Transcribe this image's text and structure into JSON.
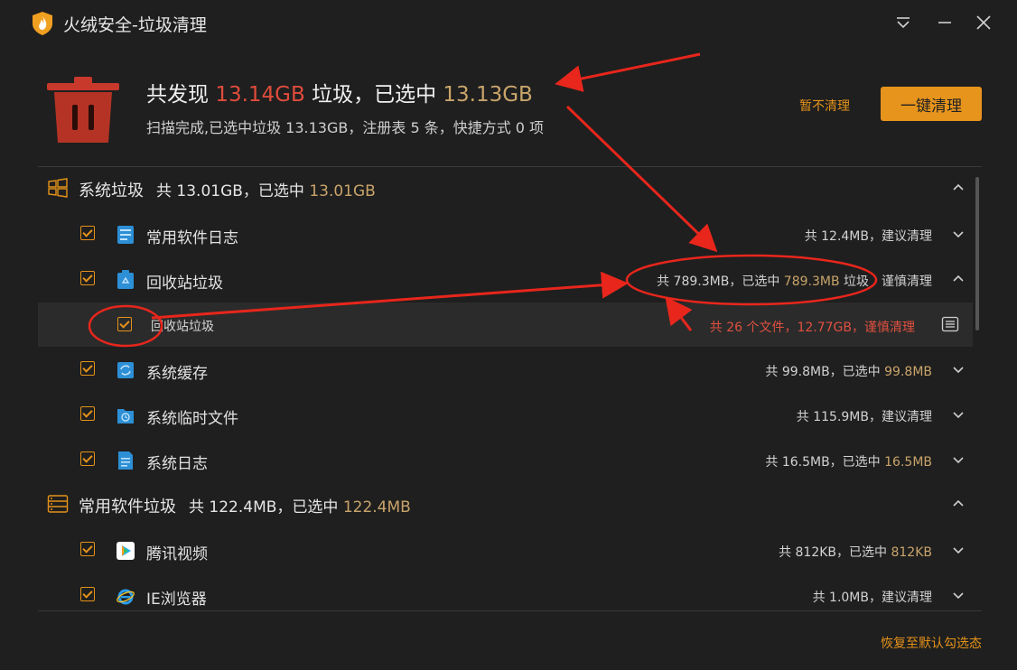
{
  "window": {
    "title": "火绒安全-垃圾清理"
  },
  "summary": {
    "prefix": "共发现 ",
    "found": "13.14GB",
    "middle": " 垃圾，已选中 ",
    "selected": "13.13GB",
    "subline": "扫描完成,已选中垃圾 13.13GB，注册表 5 条，快捷方式 0 项",
    "skip_label": "暂不清理",
    "clean_label": "一键清理"
  },
  "categories": [
    {
      "name": "系统垃圾",
      "sum_prefix": "共 13.01GB，已选中 ",
      "sum_value": "13.01GB"
    },
    {
      "name": "常用软件垃圾",
      "sum_prefix": "共 122.4MB，已选中 ",
      "sum_value": "122.4MB"
    }
  ],
  "items": [
    {
      "name": "常用软件日志",
      "stat_prefix": "共 12.4MB，建议清理",
      "stat_value": "",
      "stat_suffix": ""
    },
    {
      "name": "回收站垃圾",
      "stat_prefix": "共 789.3MB，已选中 ",
      "stat_value": "789.3MB",
      "stat_suffix": " 垃圾　谨慎清理"
    },
    {
      "name": "系统缓存",
      "stat_prefix": "共 99.8MB，已选中 ",
      "stat_value": "99.8MB",
      "stat_suffix": ""
    },
    {
      "name": "系统临时文件",
      "stat_prefix": "共 115.9MB，建议清理",
      "stat_value": "",
      "stat_suffix": ""
    },
    {
      "name": "系统日志",
      "stat_prefix": "共 16.5MB，已选中 ",
      "stat_value": "16.5MB",
      "stat_suffix": ""
    },
    {
      "name": "腾讯视频",
      "stat_prefix": "共 812KB，已选中 ",
      "stat_value": "812KB",
      "stat_suffix": ""
    },
    {
      "name": "IE浏览器",
      "stat_prefix": "共 1.0MB，建议清理",
      "stat_value": "",
      "stat_suffix": ""
    }
  ],
  "subitem": {
    "name": "回收站垃圾",
    "stat": "共 26 个文件，12.77GB，谨慎清理"
  },
  "footer": {
    "restore_label": "恢复至默认勾选态"
  },
  "colors": {
    "accent": "#e7941d",
    "danger": "#e04c3c",
    "highlight": "#c9a46a",
    "background": "#1f1f1f"
  }
}
